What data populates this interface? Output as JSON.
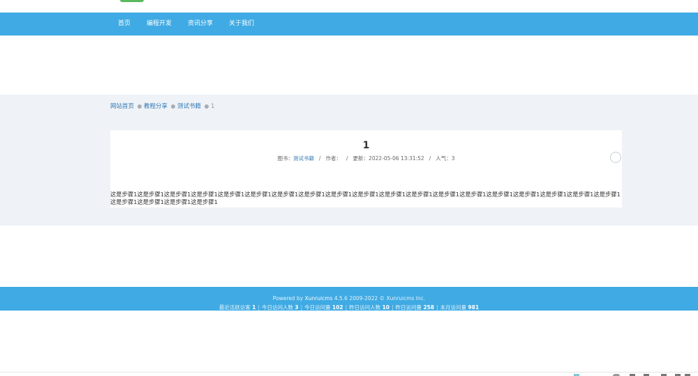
{
  "nav": {
    "items": [
      {
        "label": "首页"
      },
      {
        "label": "编程开发"
      },
      {
        "label": "资讯分享"
      },
      {
        "label": "关于我们"
      }
    ]
  },
  "breadcrumb": {
    "home": "网站首页",
    "category": "教程分享",
    "book": "测试书籍",
    "current": "1"
  },
  "article": {
    "title": "1",
    "meta": {
      "book_label": "图书：",
      "book_value": "测试书籍",
      "author_label": "作者：",
      "updated_label": "更新：",
      "updated_value": "2022-05-06 13:31:52",
      "views_label": "人气：",
      "views_value": "3"
    },
    "body": "这是步骤1这是步骤1这是步骤1这是步骤1这是步骤1这是步骤1这是步骤1这是步骤1这是步骤1这是步骤1这是步骤1这是步骤1这是步骤1这是步骤1这是步骤1这是步骤1这是步骤1这是步骤1这是步骤1这是步骤1这是步骤1这是步骤1这是步骤1"
  },
  "footer": {
    "powered_prefix": "Powered by ",
    "powered_brand": "Xunruicms",
    "powered_suffix": " 4.5.6 2009-2022 © Xunruicms Inc.",
    "stats": [
      {
        "label": "最近活跃访客",
        "value": "1"
      },
      {
        "label": "今日访问人数",
        "value": "3"
      },
      {
        "label": "今日访问量",
        "value": "102"
      },
      {
        "label": "昨日访问人数",
        "value": "10"
      },
      {
        "label": "昨日访问量",
        "value": "258"
      },
      {
        "label": "本月访问量",
        "value": "981"
      }
    ]
  },
  "colors": {
    "primary": "#3faae3",
    "content_bg": "#eff2f6",
    "link": "#337ab7"
  }
}
